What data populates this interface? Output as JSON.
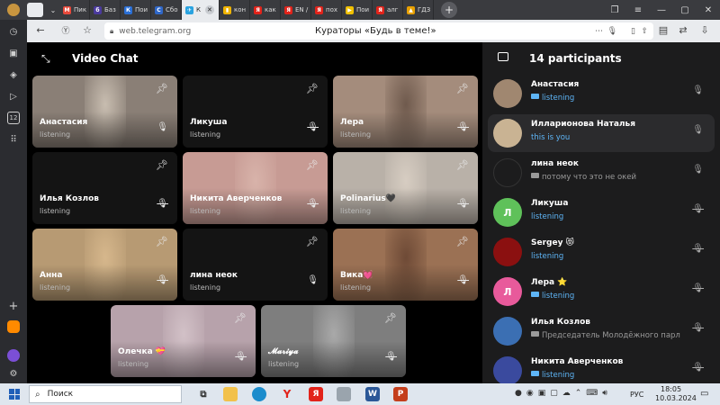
{
  "browser": {
    "tabs": [
      {
        "label": "Пик",
        "color": "#e84a3c",
        "glyph": "М"
      },
      {
        "label": "Баз",
        "color": "#4b3a9e",
        "glyph": "б"
      },
      {
        "label": "Пои",
        "color": "#2a6fd6",
        "glyph": "К"
      },
      {
        "label": "Сбо",
        "color": "#2f67c8",
        "glyph": "С"
      },
      {
        "label": "К",
        "color": "#2aa3e0",
        "glyph": "✈"
      },
      {
        "label": "кон",
        "color": "#f0b400",
        "glyph": "▮"
      },
      {
        "label": "как",
        "color": "#e2231a",
        "glyph": "Я"
      },
      {
        "label": "EN /",
        "color": "#e2231a",
        "glyph": "Я"
      },
      {
        "label": "пох",
        "color": "#e2231a",
        "glyph": "Я"
      },
      {
        "label": "Пои",
        "color": "#f0c000",
        "glyph": "▶"
      },
      {
        "label": "алг",
        "color": "#e2231a",
        "glyph": "Я"
      },
      {
        "label": "ГДЗ",
        "color": "#e8a000",
        "glyph": "▲"
      }
    ],
    "url": "web.telegram.org",
    "page_title": "Кураторы «Будь в теме!»"
  },
  "videochat": {
    "title": "Video Chat",
    "participants_header": "14 participants",
    "tiles": [
      {
        "name": "Анастасия",
        "status": "listening",
        "mic": "on",
        "video": true,
        "bg": "#8a7f76",
        "cam": "#c8bdb0"
      },
      {
        "name": "Ликуша",
        "status": "listening",
        "mic": "off",
        "video": false,
        "bg": "#141414",
        "cam": "#141414"
      },
      {
        "name": "Лера",
        "status": "listening",
        "mic": "off",
        "video": true,
        "bg": "#a48c7c",
        "cam": "#6f5a4d"
      },
      {
        "name": "Илья Козлов",
        "status": "listening",
        "mic": "off",
        "video": false,
        "bg": "#141414",
        "cam": "#141414"
      },
      {
        "name": "Никита Аверченков",
        "status": "listening",
        "mic": "off",
        "video": true,
        "bg": "#c79b94",
        "cam": "#d8b3aa"
      },
      {
        "name": "Polinarius🖤",
        "status": "listening",
        "mic": "off",
        "video": true,
        "bg": "#b9b1a8",
        "cam": "#d7cdc2"
      },
      {
        "name": "Анна",
        "status": "listening",
        "mic": "off",
        "video": true,
        "bg": "#b79a73",
        "cam": "#d6b78c"
      },
      {
        "name": "лина неок",
        "status": "listening",
        "mic": "on",
        "video": false,
        "bg": "#141414",
        "cam": "#141414"
      },
      {
        "name": "Вика💓",
        "status": "listening",
        "mic": "off",
        "video": true,
        "bg": "#9b7154",
        "cam": "#6e4a36"
      },
      {
        "name": "Олечка 💝",
        "status": "listening",
        "mic": "off",
        "video": true,
        "bg": "#b7a2ab",
        "cam": "#d2c1c7"
      },
      {
        "name": "𝓜𝓪𝓻𝓲𝔂𝓪",
        "status": "listening",
        "mic": "off",
        "video": true,
        "bg": "#7e7e7e",
        "cam": "#a9a9a9"
      }
    ],
    "participants": [
      {
        "name": "Анастасия",
        "status": "listening",
        "status_color": "#5eb5f7",
        "video": true,
        "mic": "on",
        "avatar": "#a08770",
        "initial": ""
      },
      {
        "name": "Илларионова Наталья",
        "status": "this is you",
        "status_color": "#5eb5f7",
        "video": false,
        "mic": "on",
        "avatar": "#c9b393",
        "initial": "",
        "highlight": true
      },
      {
        "name": "лина неок",
        "status": "потому что это не окей",
        "status_color": "#9a9a9a",
        "video": true,
        "video_color": "#9a9a9a",
        "mic": "on",
        "avatar": "#1c1c1d",
        "initial": ""
      },
      {
        "name": "Ликуша",
        "status": "listening",
        "status_color": "#5eb5f7",
        "video": false,
        "mic": "off",
        "avatar": "#5fc15a",
        "initial": "Л"
      },
      {
        "name": "Sergey 😻",
        "status": "listening",
        "status_color": "#5eb5f7",
        "video": false,
        "mic": "off",
        "avatar": "#8b1010",
        "initial": ""
      },
      {
        "name": "Лера ⭐",
        "status": "listening",
        "status_color": "#5eb5f7",
        "video": true,
        "mic": "off",
        "avatar": "#e85a9b",
        "initial": "Л"
      },
      {
        "name": "Илья Козлов",
        "status": "Председатель Молодёжного парл",
        "status_color": "#9a9a9a",
        "video": true,
        "video_color": "#9a9a9a",
        "mic": "off",
        "avatar": "#3b6fb3",
        "initial": ""
      },
      {
        "name": "Никита Аверченков",
        "status": "listening",
        "status_color": "#5eb5f7",
        "video": true,
        "mic": "off",
        "avatar": "#3a4a9e",
        "initial": ""
      }
    ]
  },
  "taskbar": {
    "search_label": "Поиск",
    "lang": "РУС",
    "time": "18:05",
    "date": "10.03.2024"
  }
}
